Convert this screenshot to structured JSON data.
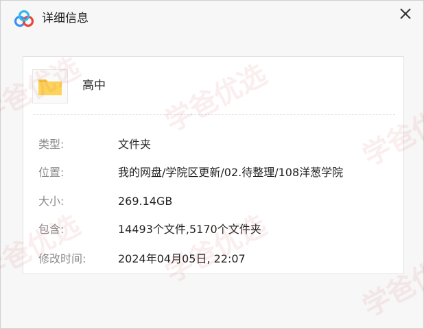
{
  "window": {
    "title": "详细信息",
    "app_icon": "baidu-netdisk-cloud-icon",
    "close_icon": "close-icon",
    "accent_color": "#2f8cf3"
  },
  "file": {
    "icon": "folder-icon",
    "name": "高中",
    "fields": [
      {
        "label": "类型:",
        "value": "文件夹"
      },
      {
        "label": "位置:",
        "value": "我的网盘/学院区更新/02.待整理/108洋葱学院"
      },
      {
        "label": "大小:",
        "value": "269.14GB"
      },
      {
        "label": "包含:",
        "value": "14493个文件,5170个文件夹"
      },
      {
        "label": "修改时间:",
        "value": "2024年04月05日, 22:07"
      }
    ]
  },
  "watermark": {
    "text": "学爸优选",
    "color": "#cd5a5a"
  }
}
